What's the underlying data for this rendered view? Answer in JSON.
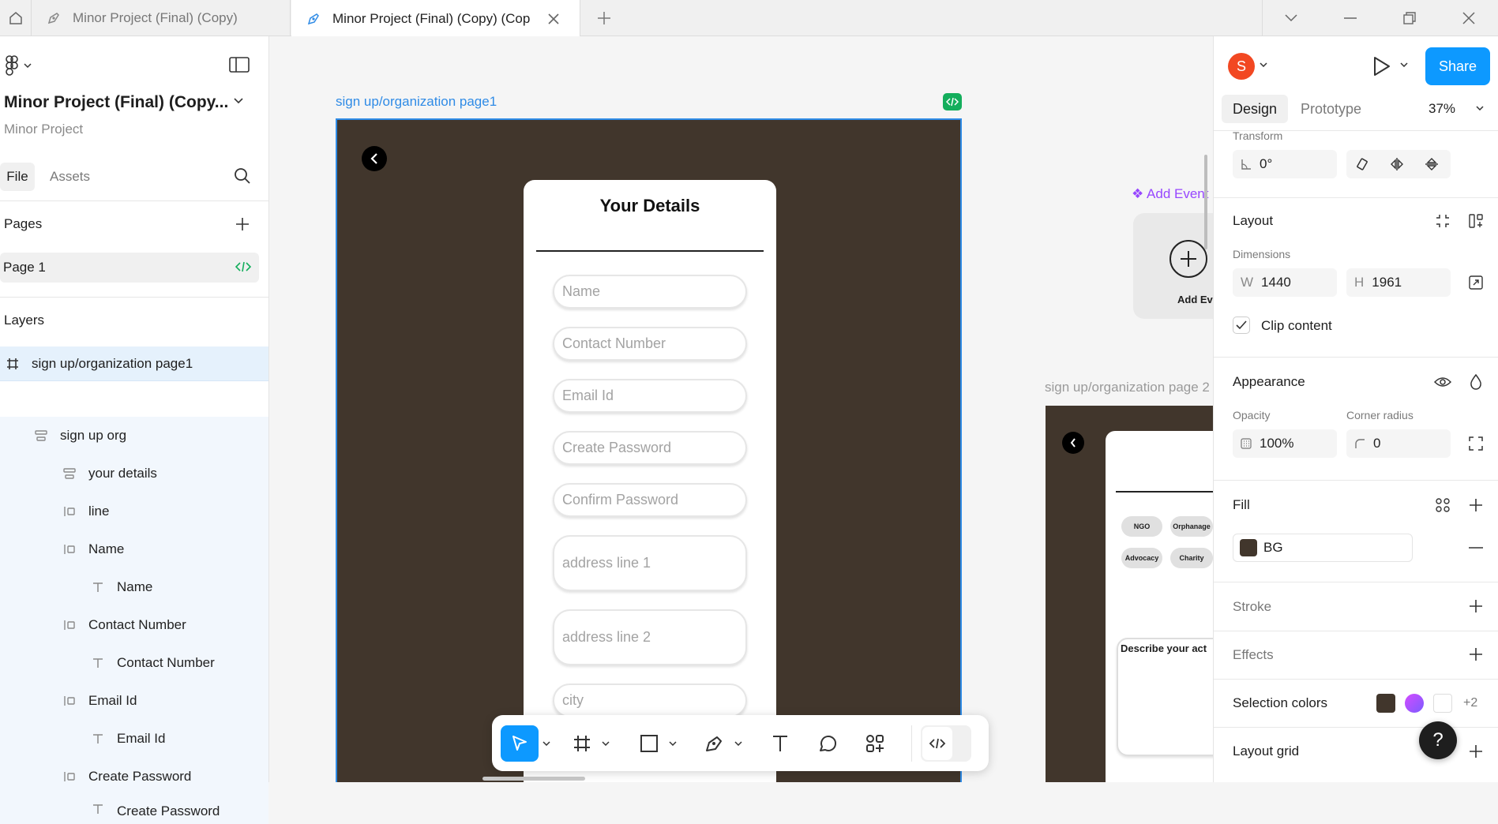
{
  "titlebar": {
    "tabs": [
      {
        "label": "Minor Project (Final) (Copy)"
      },
      {
        "label": "Minor Project (Final) (Copy) (Cop"
      }
    ]
  },
  "left": {
    "file_name": "Minor Project (Final) (Copy...",
    "project_name": "Minor Project",
    "tab_file": "File",
    "tab_assets": "Assets",
    "pages_title": "Pages",
    "page1": "Page 1",
    "layers_title": "Layers",
    "layers": [
      {
        "name": "sign up/organization page1"
      },
      {
        "name": "sign up org"
      },
      {
        "name": "your details"
      },
      {
        "name": "line"
      },
      {
        "name": "Name"
      },
      {
        "name": "Name"
      },
      {
        "name": "Contact Number"
      },
      {
        "name": "Contact Number"
      },
      {
        "name": "Email Id"
      },
      {
        "name": "Email Id"
      },
      {
        "name": "Create Password"
      },
      {
        "name": "Create Password"
      }
    ]
  },
  "canvas": {
    "frame1_label": "sign up/organization page1",
    "frame2_label": "sign up/organization page 2",
    "card_title": "Your Details",
    "fields": [
      "Name",
      "Contact Number",
      "Email Id",
      "Create Password",
      "Confirm Password",
      "address line 1",
      "address line 2",
      "city"
    ],
    "add_event_link": "❖ Add Event",
    "add_event_card": "Add Ev",
    "tags": [
      "NGO",
      "Orphanage",
      "Advocacy",
      "Charity"
    ],
    "describe_label": "Describe your act",
    "frame_bg": "#41362c",
    "selection_color": "#2f8be6"
  },
  "right": {
    "avatar_letter": "S",
    "avatar_color": "#f24822",
    "share_label": "Share",
    "share_color": "#0d99ff",
    "tab_design": "Design",
    "tab_prototype": "Prototype",
    "zoom": "37%",
    "transform_label": "Transform",
    "rotation": "0°",
    "layout_title": "Layout",
    "dimensions_label": "Dimensions",
    "w_label": "W",
    "w_value": "1440",
    "h_label": "H",
    "h_value": "1961",
    "clip_content": "Clip content",
    "appearance_title": "Appearance",
    "opacity_label": "Opacity",
    "opacity_value": "100%",
    "radius_label": "Corner radius",
    "radius_value": "0",
    "fill_title": "Fill",
    "fill_name": "BG",
    "fill_color": "#41362c",
    "stroke_title": "Stroke",
    "effects_title": "Effects",
    "selection_colors_title": "Selection colors",
    "selection_more": "+2",
    "layout_grid_title": "Layout grid",
    "help": "?"
  }
}
